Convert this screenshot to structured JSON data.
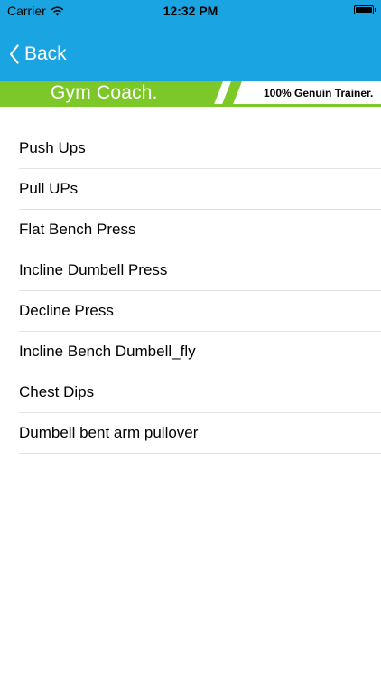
{
  "status_bar": {
    "carrier": "Carrier",
    "time": "12:32 PM"
  },
  "nav": {
    "back_label": "Back"
  },
  "banner": {
    "title": "Gym Coach.",
    "tagline": "100% Genuin Trainer."
  },
  "exercises": [
    {
      "label": "Push Ups"
    },
    {
      "label": "Pull UPs"
    },
    {
      "label": "Flat Bench Press"
    },
    {
      "label": "Incline Dumbell Press"
    },
    {
      "label": "Decline Press"
    },
    {
      "label": "Incline Bench Dumbell_fly"
    },
    {
      "label": "Chest Dips"
    },
    {
      "label": "Dumbell bent arm pullover"
    }
  ],
  "colors": {
    "nav_blue": "#1aa4e2",
    "banner_green": "#7cc829"
  }
}
